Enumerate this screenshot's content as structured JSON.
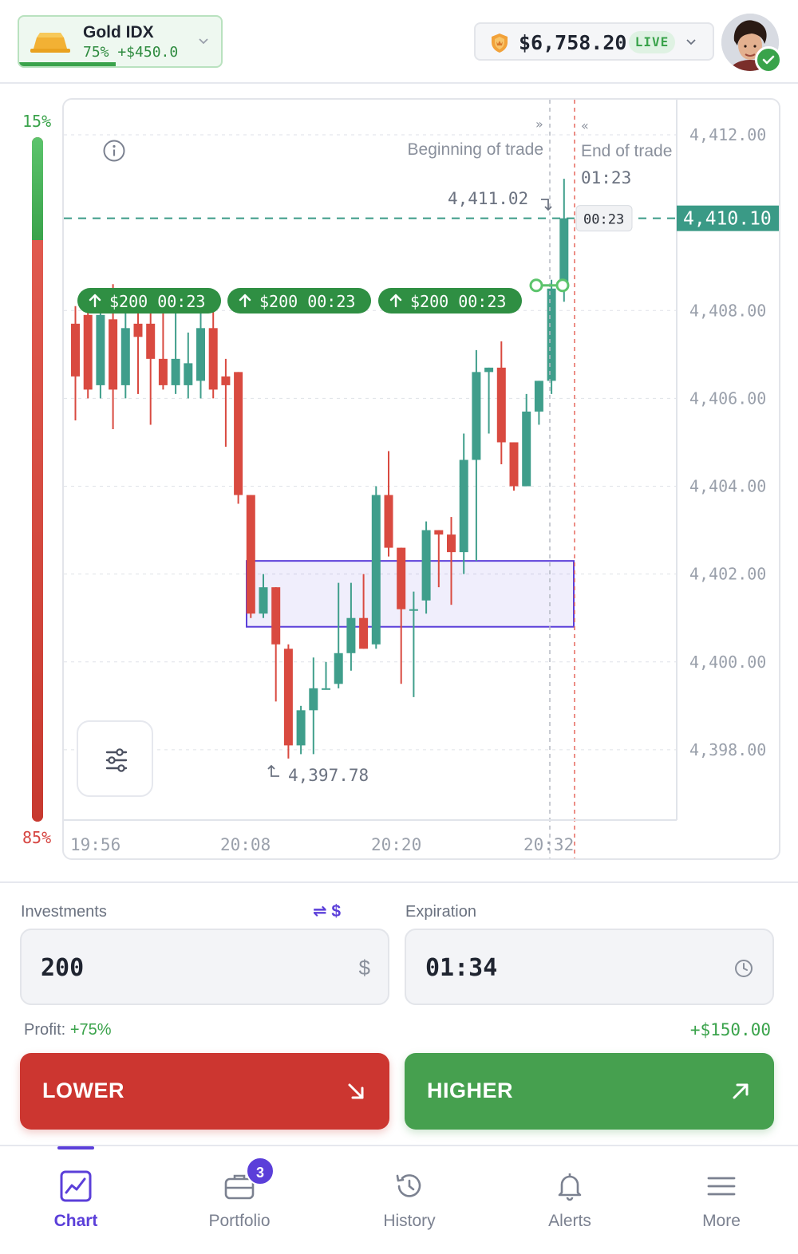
{
  "header": {
    "asset": {
      "name": "Gold IDX",
      "payout_and_pnl": "75% +$450.0",
      "progress_fraction": 0.75
    },
    "balance": {
      "value": "$6,758.20",
      "mode": "LIVE"
    },
    "avatar": {
      "status": "verified"
    }
  },
  "payout_bar": {
    "higher_pct": "15%",
    "lower_pct": "85%",
    "higher_fraction": 0.15
  },
  "chart": {
    "beginning_label": "Beginning of trade",
    "end_label": "End of trade",
    "end_timer": "01:23",
    "current_price": "4,410.10",
    "price_timer": "00:23",
    "high_label": "4,411.02",
    "low_label": "4,397.78",
    "trade_tags": [
      {
        "label": "$200 00:23"
      },
      {
        "label": "$200 00:23"
      },
      {
        "label": "$200 00:23"
      }
    ],
    "y_ticks": [
      "4,412.00",
      "4,408.00",
      "4,406.00",
      "4,404.00",
      "4,402.00",
      "4,400.00",
      "4,398.00"
    ],
    "x_ticks": [
      "19:56",
      "20:08",
      "20:20",
      "20:32"
    ],
    "colors": {
      "up": "#3f9e8b",
      "down": "#d94a40",
      "accent": "#5b3fd9",
      "current": "#3a9a86"
    }
  },
  "chart_data": {
    "type": "candlestick",
    "x_ticks": [
      "19:56",
      "20:08",
      "20:20",
      "20:32"
    ],
    "y_ticks": [
      4398,
      4400,
      4402,
      4404,
      4406,
      4408,
      4410,
      4412
    ],
    "ylim": [
      4396.4,
      4412.8
    ],
    "current_price": 4410.1,
    "high": 4411.02,
    "low": 4397.78,
    "zone": {
      "from_price": 4400.8,
      "to_price": 4402.3
    },
    "candles": [
      [
        4407.7,
        4408.1,
        4405.5,
        4406.5
      ],
      [
        4407.9,
        4408.4,
        4406.0,
        4406.2
      ],
      [
        4406.3,
        4408.0,
        4406.0,
        4407.9
      ],
      [
        4407.8,
        4408.6,
        4405.3,
        4406.2
      ],
      [
        4406.3,
        4408.5,
        4406.0,
        4407.6
      ],
      [
        4407.7,
        4408.4,
        4406.1,
        4407.4
      ],
      [
        4407.7,
        4408.5,
        4405.4,
        4406.9
      ],
      [
        4406.9,
        4408.5,
        4406.2,
        4406.3
      ],
      [
        4406.3,
        4408.3,
        4406.1,
        4406.9
      ],
      [
        4406.3,
        4407.5,
        4406.0,
        4406.8
      ],
      [
        4406.4,
        4408.3,
        4406.0,
        4407.6
      ],
      [
        4407.6,
        4408.2,
        4406.0,
        4406.2
      ],
      [
        4406.5,
        4406.9,
        4404.9,
        4406.3
      ],
      [
        4406.6,
        4406.6,
        4403.6,
        4403.8
      ],
      [
        4403.8,
        4403.8,
        4401.0,
        4401.1
      ],
      [
        4401.1,
        4402.0,
        4401.0,
        4401.7
      ],
      [
        4401.7,
        4401.7,
        4399.1,
        4400.4
      ],
      [
        4400.3,
        4400.4,
        4397.8,
        4398.1
      ],
      [
        4398.1,
        4399.0,
        4397.9,
        4398.9
      ],
      [
        4398.9,
        4400.1,
        4397.9,
        4399.4
      ],
      [
        4399.4,
        4400.0,
        4399.4,
        4399.4
      ],
      [
        4399.5,
        4401.8,
        4399.4,
        4400.2
      ],
      [
        4400.2,
        4401.8,
        4399.8,
        4401.0
      ],
      [
        4401.0,
        4402.0,
        4400.3,
        4400.3
      ],
      [
        4400.4,
        4404.0,
        4400.3,
        4403.8
      ],
      [
        4403.8,
        4404.8,
        4402.4,
        4402.6
      ],
      [
        4402.6,
        4402.6,
        4399.5,
        4401.2
      ],
      [
        4401.2,
        4401.6,
        4399.2,
        4401.2
      ],
      [
        4401.4,
        4403.2,
        4401.1,
        4403.0
      ],
      [
        4403.0,
        4403.0,
        4401.7,
        4402.9
      ],
      [
        4402.9,
        4403.3,
        4401.3,
        4402.5
      ],
      [
        4402.5,
        4405.2,
        4402.0,
        4404.6
      ],
      [
        4404.6,
        4407.1,
        4402.3,
        4406.6
      ],
      [
        4406.6,
        4406.7,
        4405.2,
        4406.7
      ],
      [
        4406.7,
        4407.3,
        4404.5,
        4405.0
      ],
      [
        4405.0,
        4405.0,
        4403.9,
        4404.0
      ],
      [
        4404.0,
        4406.1,
        4404.0,
        4405.7
      ],
      [
        4405.7,
        4406.4,
        4405.4,
        4406.4
      ],
      [
        4406.4,
        4408.7,
        4406.1,
        4408.5
      ],
      [
        4408.5,
        4411.0,
        4408.2,
        4410.1
      ]
    ]
  },
  "trade": {
    "investments_label": "Investments",
    "currency_toggle": "⇌ $",
    "investment_value": "200",
    "investment_currency": "$",
    "expiration_label": "Expiration",
    "expiration_value": "01:34",
    "profit_label": "Profit:",
    "profit_pct": "+75%",
    "profit_amount": "+$150.00",
    "lower_label": "LOWER",
    "higher_label": "HIGHER"
  },
  "nav": {
    "items": [
      {
        "label": "Chart"
      },
      {
        "label": "Portfolio",
        "badge": "3"
      },
      {
        "label": "History"
      },
      {
        "label": "Alerts"
      },
      {
        "label": "More"
      }
    ],
    "active": "Chart"
  }
}
